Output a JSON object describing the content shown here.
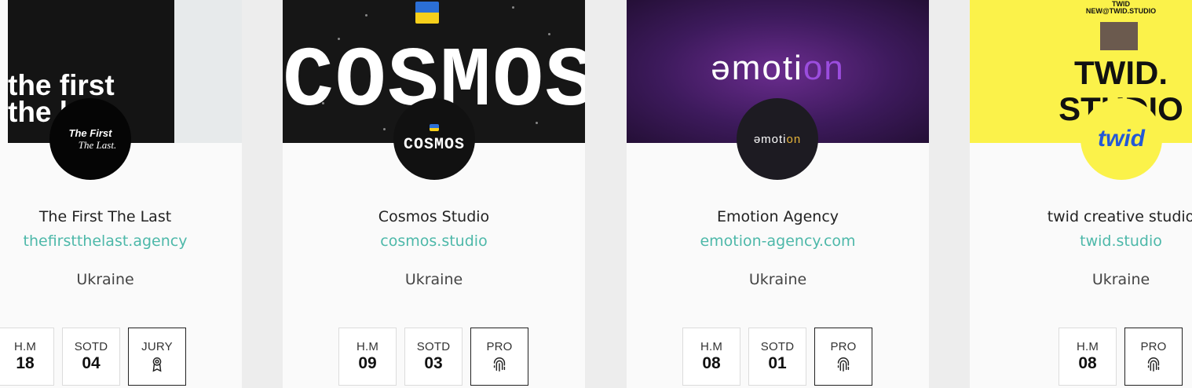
{
  "cards": [
    {
      "cover_text": "the first the l",
      "avatar_text_1": "The First",
      "avatar_text_2": "The Last.",
      "name": "The First The Last",
      "url": "thefirstthelast.agency",
      "country": "Ukraine",
      "stats": [
        {
          "label": "H.M",
          "value": "18"
        },
        {
          "label": "SOTD",
          "value": "04"
        },
        {
          "label": "JURY",
          "icon": "jury-badge-icon"
        }
      ]
    },
    {
      "cover_text": "COSMOS",
      "avatar_text": "COSMOS",
      "name": "Cosmos Studio",
      "url": "cosmos.studio",
      "country": "Ukraine",
      "stats": [
        {
          "label": "H.M",
          "value": "09"
        },
        {
          "label": "SOTD",
          "value": "03"
        },
        {
          "label": "PRO",
          "icon": "fingerprint-icon"
        }
      ]
    },
    {
      "cover_text_a": "əmoti",
      "cover_text_b": "on",
      "avatar_text_a": "əmoti",
      "avatar_text_b": "on",
      "name": "Emotion Agency",
      "url": "emotion-agency.com",
      "country": "Ukraine",
      "stats": [
        {
          "label": "H.M",
          "value": "08"
        },
        {
          "label": "SOTD",
          "value": "01"
        },
        {
          "label": "PRO",
          "icon": "fingerprint-icon"
        }
      ]
    },
    {
      "cover_line_1": "TWID",
      "cover_line_2": "NEW@TWID.STUDIO",
      "cover_big_1": "TWID.",
      "cover_big_2": "STUDIO",
      "avatar_text": "twid",
      "name": "twid creative studio",
      "url": "twid.studio",
      "country": "Ukraine",
      "stats": [
        {
          "label": "H.M",
          "value": "08"
        },
        {
          "label": "PRO",
          "icon": "fingerprint-icon"
        }
      ]
    }
  ],
  "colors": {
    "accent": "#4db8a9",
    "card_bg": "#fafafa",
    "page_bg": "#ededed",
    "twid_yellow": "#fbf24a",
    "emotion_purple": "#6a2c8e"
  }
}
